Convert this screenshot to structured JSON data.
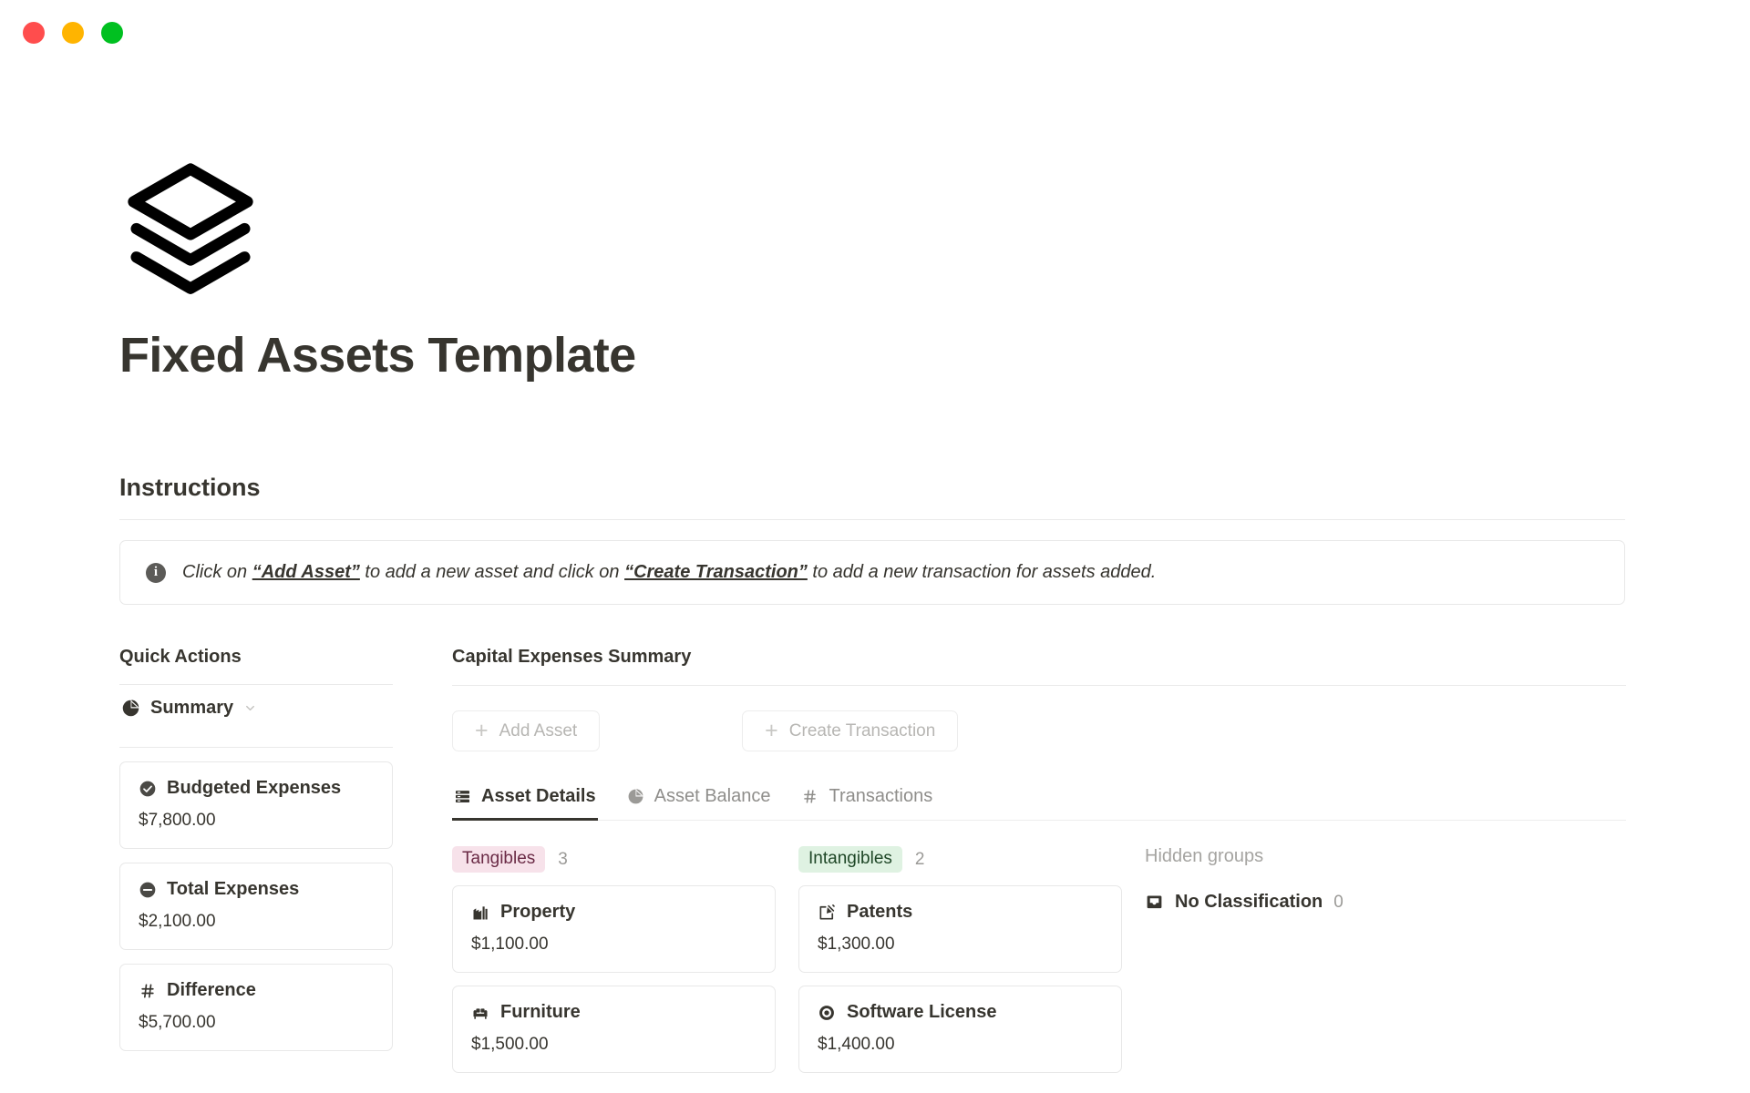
{
  "window": {
    "controls": [
      {
        "name": "close",
        "color": "#ff4d4d"
      },
      {
        "name": "minimize",
        "color": "#ffb400"
      },
      {
        "name": "maximize",
        "color": "#00c020"
      }
    ]
  },
  "header": {
    "icon": "layers-icon",
    "title": "Fixed Assets Template"
  },
  "instructions": {
    "heading": "Instructions",
    "icon": "info-icon",
    "callout": {
      "text_part_1": "Click on ",
      "emphasis_1": "“Add Asset”",
      "text_part_2": " to add a new asset and click on ",
      "emphasis_2": "“Create Transaction”",
      "text_part_3": " to add a new transaction for assets added."
    }
  },
  "sidebar": {
    "title": "Quick Actions",
    "summary": {
      "icon": "pie-chart-icon",
      "label": "Summary",
      "chevron": "chevron-down-icon"
    },
    "stats": [
      {
        "icon": "check-circle-icon",
        "name": "Budgeted Expenses",
        "value": "$7,800.00"
      },
      {
        "icon": "minus-circle-icon",
        "name": "Total Expenses",
        "value": "$2,100.00"
      },
      {
        "icon": "hash-icon",
        "name": "Difference",
        "value": "$5,700.00"
      }
    ]
  },
  "main": {
    "title": "Capital Expenses Summary",
    "actions": [
      {
        "icon": "plus-icon",
        "label": "Add Asset"
      },
      {
        "icon": "plus-icon",
        "label": "Create Transaction"
      }
    ],
    "tabs": [
      {
        "icon": "list-rows-icon",
        "label": "Asset Details",
        "active": true
      },
      {
        "icon": "pie-chart-icon",
        "label": "Asset Balance",
        "active": false
      },
      {
        "icon": "hash-icon",
        "label": "Transactions",
        "active": false
      }
    ],
    "groups": [
      {
        "label": "Tangibles",
        "count": "3",
        "badge_bg": "#f7e2ea",
        "badge_fg": "#6a2a45",
        "items": [
          {
            "icon": "building-icon",
            "name": "Property",
            "value": "$1,100.00"
          },
          {
            "icon": "sofa-icon",
            "name": "Furniture",
            "value": "$1,500.00"
          }
        ]
      },
      {
        "label": "Intangibles",
        "count": "2",
        "badge_bg": "#dff2e2",
        "badge_fg": "#1f4727",
        "items": [
          {
            "icon": "pencil-square-icon",
            "name": "Patents",
            "value": "$1,300.00"
          },
          {
            "icon": "target-icon",
            "name": "Software License",
            "value": "$1,400.00"
          }
        ]
      }
    ],
    "hidden_groups": {
      "title": "Hidden groups",
      "items": [
        {
          "icon": "inbox-icon",
          "name": "No Classification",
          "count": "0"
        }
      ]
    }
  }
}
